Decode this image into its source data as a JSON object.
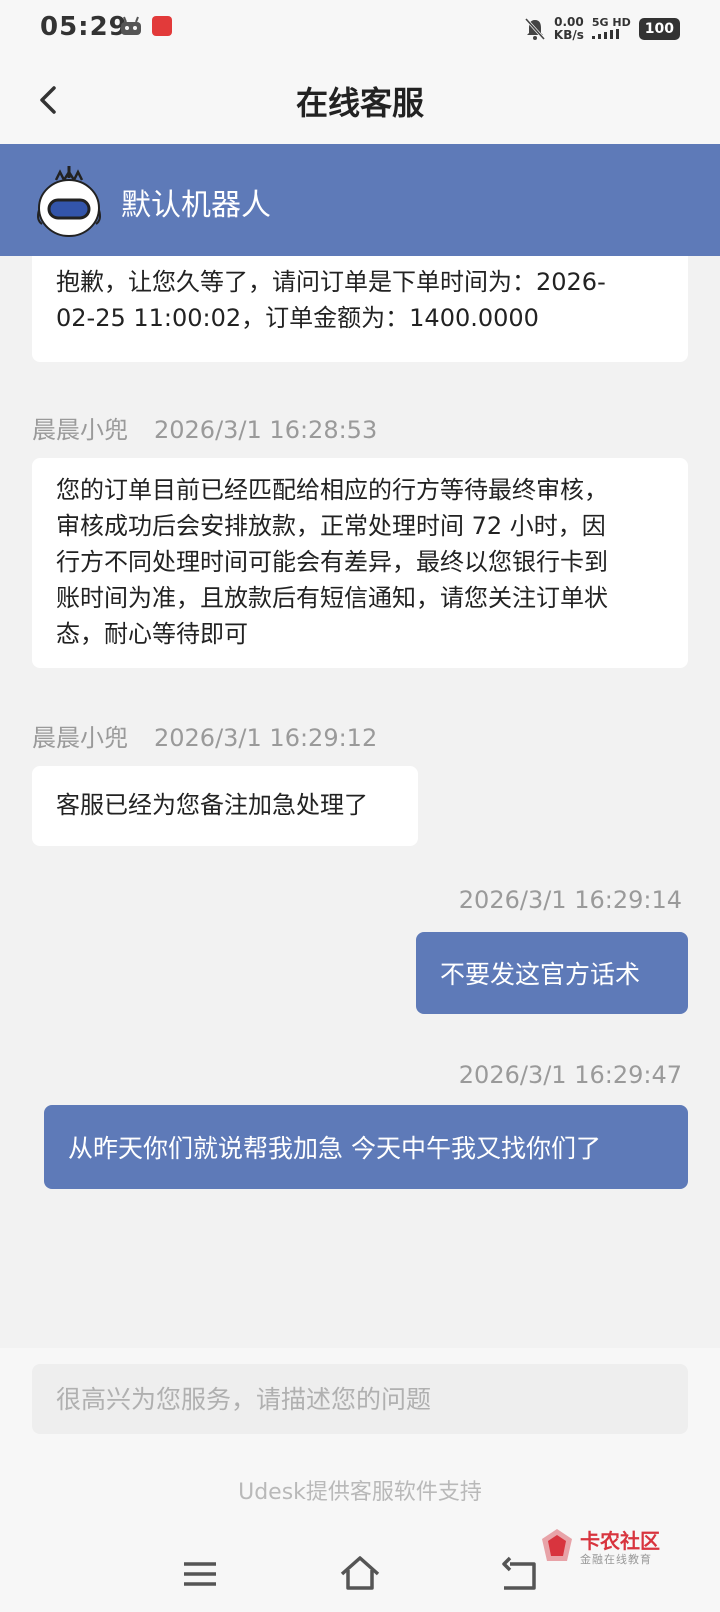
{
  "status_bar": {
    "time": "05:29",
    "net_speed": "0.00",
    "net_unit": "KB/s",
    "signal_label": "5G HD",
    "battery": "100"
  },
  "header": {
    "title": "在线客服"
  },
  "agent": {
    "name": "默认机器人"
  },
  "messages": [
    {
      "direction": "in",
      "sender": "",
      "time": "",
      "lines": [
        "抱歉，让您久等了，请问订单是下单时间为：2026-",
        "02-25 11:00:02，订单金额为：1400.0000"
      ]
    },
    {
      "direction": "in",
      "sender": "晨晨小兜",
      "time": "2026/3/1 16:28:53",
      "lines": [
        "您的订单目前已经匹配给相应的行方等待最终审核，",
        "审核成功后会安排放款，正常处理时间 72 小时，因",
        "行方不同处理时间可能会有差异，最终以您银行卡到",
        "账时间为准，且放款后有短信通知，请您关注订单状",
        "态，耐心等待即可"
      ]
    },
    {
      "direction": "in",
      "sender": "晨晨小兜",
      "time": "2026/3/1 16:29:12",
      "lines": [
        "客服已经为您备注加急处理了"
      ]
    },
    {
      "direction": "out",
      "sender": "",
      "time": "2026/3/1 16:29:14",
      "lines": [
        "不要发这官方话术"
      ]
    },
    {
      "direction": "out",
      "sender": "",
      "time": "2026/3/1 16:29:47",
      "lines": [
        "从昨天你们就说帮我加急 今天中午我又找你们了"
      ]
    }
  ],
  "input": {
    "placeholder": "很高兴为您服务，请描述您的问题",
    "value": ""
  },
  "footer": {
    "powered_by": "Udesk提供客服软件支持"
  },
  "watermark": {
    "title": "卡农社区",
    "subtitle": "金融在线教育"
  },
  "colors": {
    "brand": "#5e7ab8",
    "background": "#f2f2f2",
    "bubble_in": "#ffffff",
    "meta_text": "#9a9a9a"
  },
  "icons": [
    "back-arrow-icon",
    "robot-avatar-icon",
    "menu-icon",
    "home-icon",
    "return-icon",
    "mute-bell-icon"
  ]
}
